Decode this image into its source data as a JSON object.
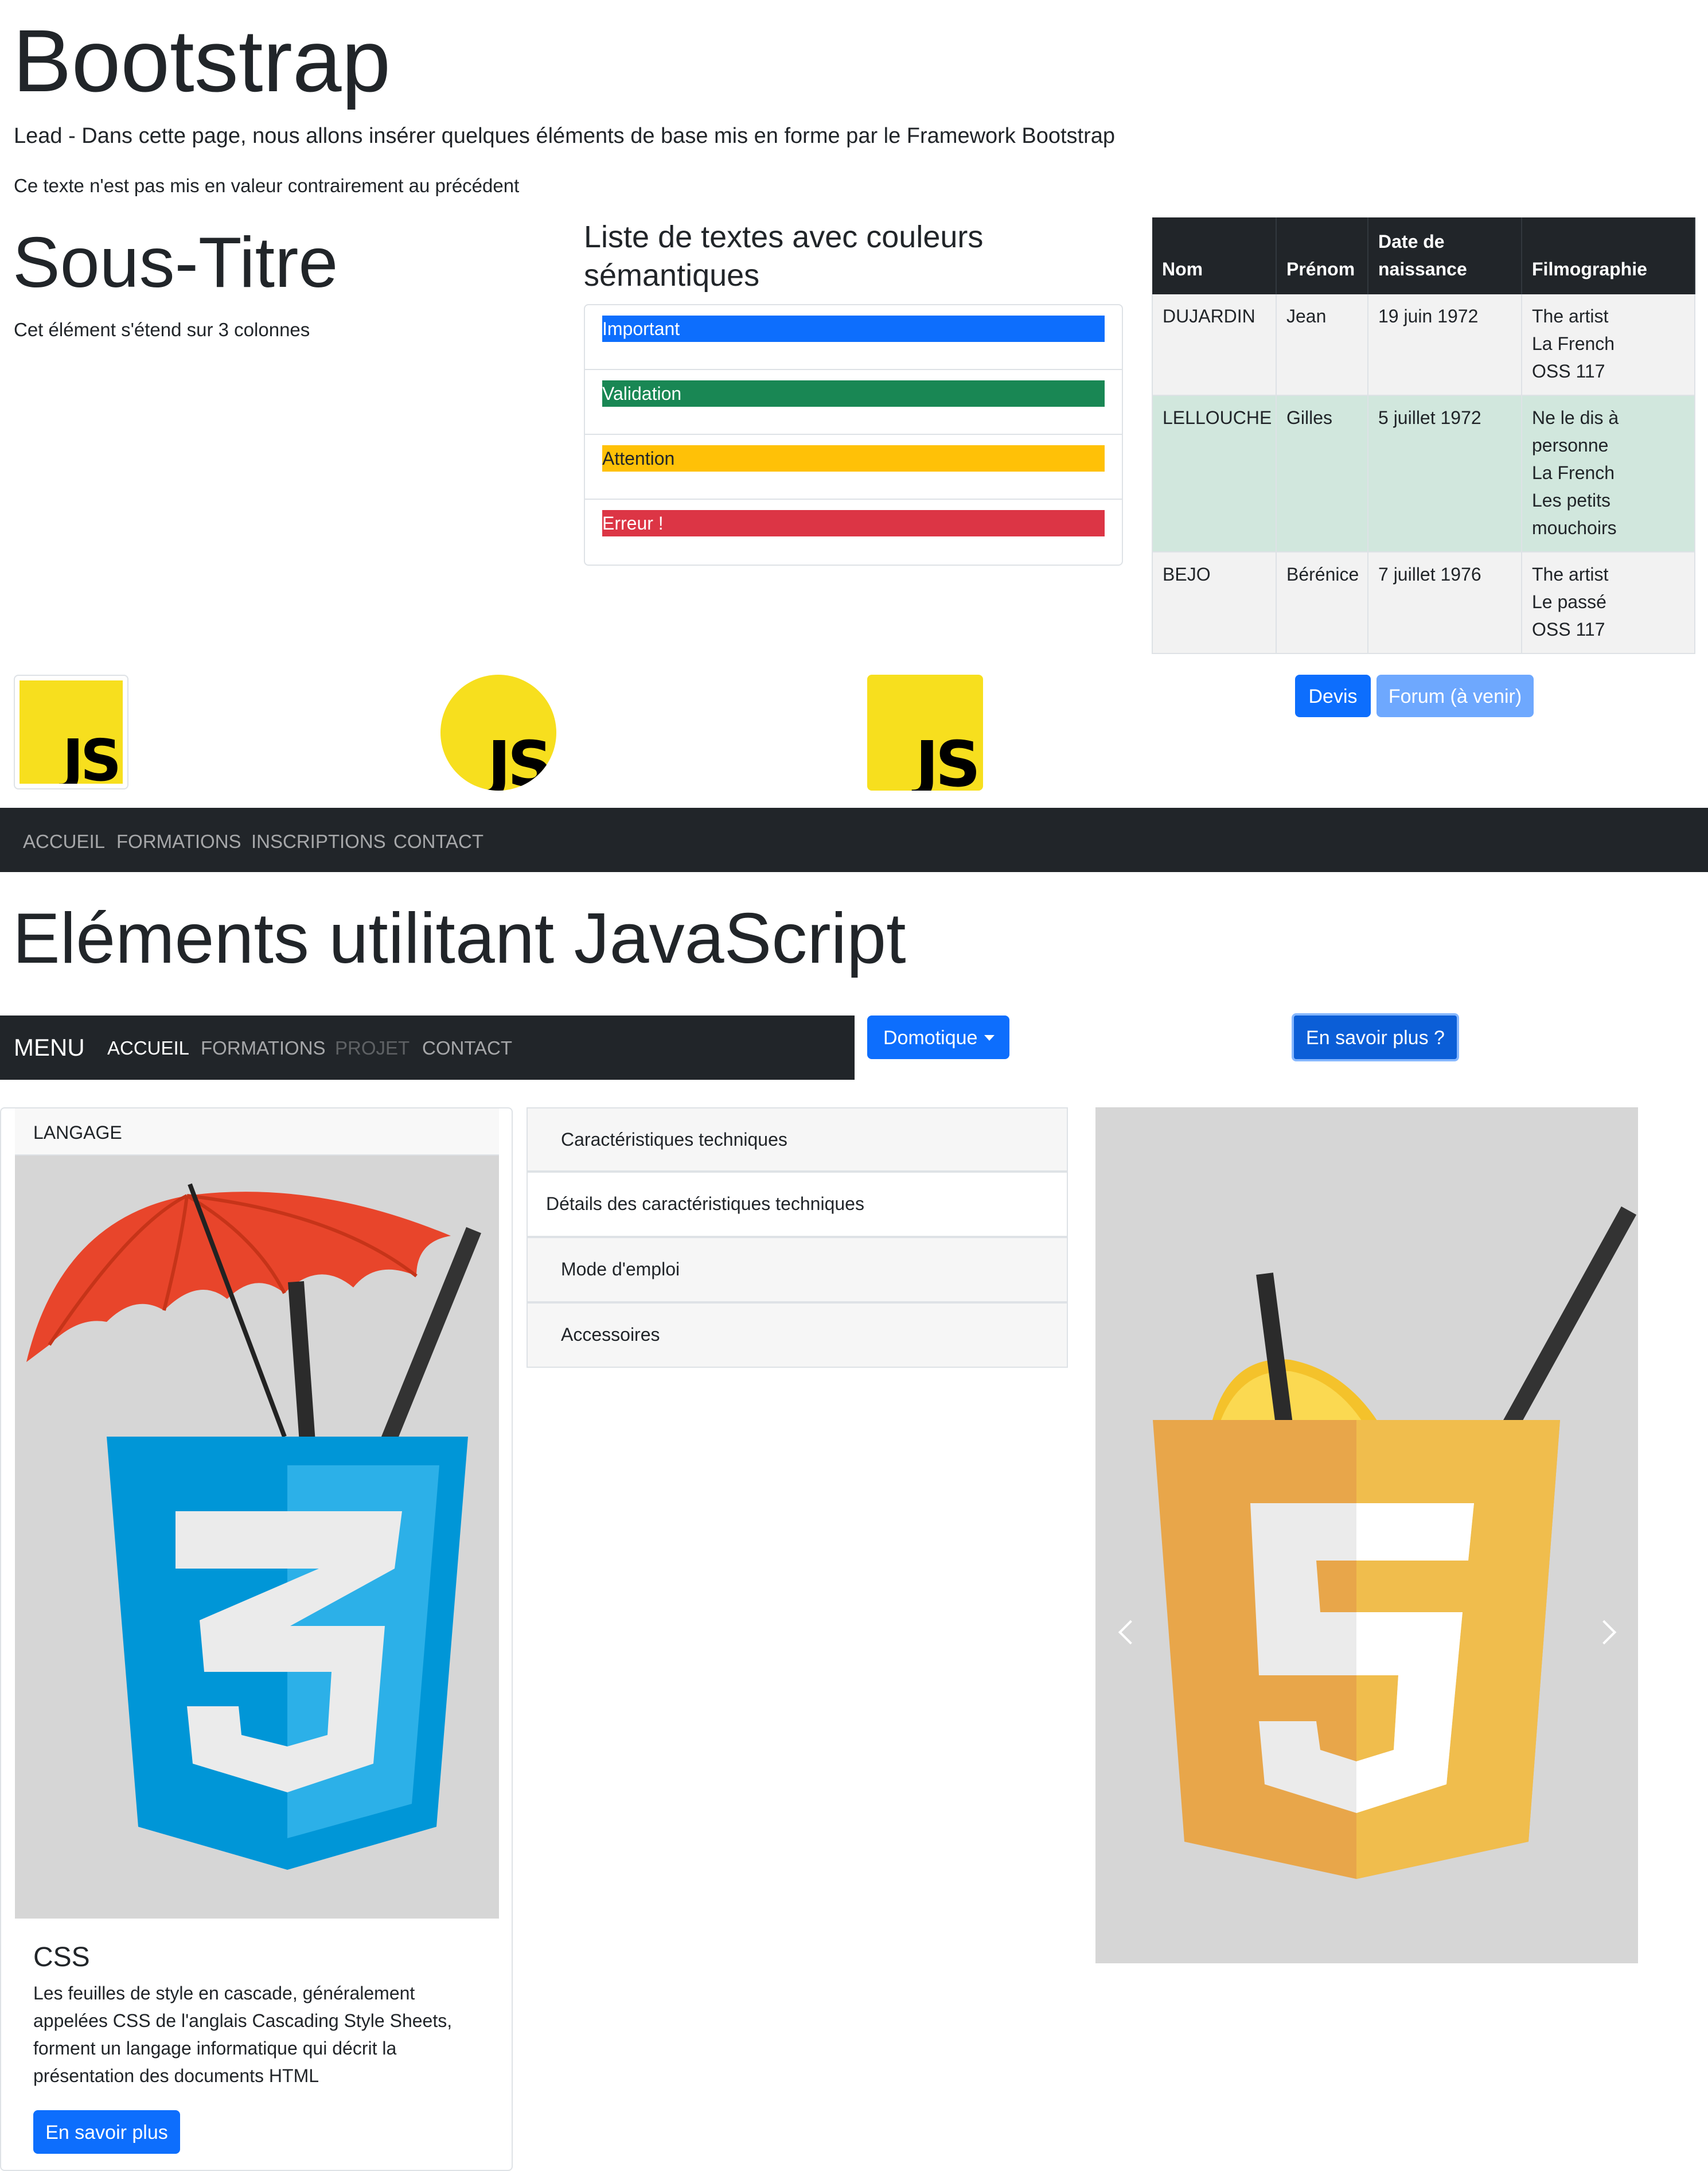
{
  "header": {
    "title": "Bootstrap",
    "lead": "Lead - Dans cette page, nous allons insérer quelques éléments de base mis en forme par le Framework Bootstrap",
    "paragraph": "Ce texte n'est pas mis en valeur contrairement au précédent"
  },
  "section1": {
    "subtitle": "Sous-Titre",
    "description": "Cet élément s'étend sur 3 colonnes"
  },
  "semantic_list": {
    "title": "Liste de textes avec couleurs sémantiques",
    "items": [
      {
        "label": "Important",
        "color": "#0d6efd"
      },
      {
        "label": "Validation",
        "color": "#198754"
      },
      {
        "label": "Attention",
        "color": "#ffc107"
      },
      {
        "label": "Erreur !",
        "color": "#dc3545"
      }
    ]
  },
  "table": {
    "headers": {
      "nom": "Nom",
      "prenom": "Prénom",
      "date": "Date de naissance",
      "films": "Filmographie"
    },
    "rows": [
      {
        "nom": "DUJARDIN",
        "prenom": "Jean",
        "date": "19 juin 1972",
        "films": [
          "The artist",
          "La French",
          "OSS 117"
        ]
      },
      {
        "nom": "LELLOUCHE",
        "prenom": "Gilles",
        "date": "5 juillet 1972",
        "films": [
          "Ne le dis à",
          "personne",
          "La French",
          "Les petits",
          "mouchoirs"
        ]
      },
      {
        "nom": "BEJO",
        "prenom": "Bérénice",
        "date": "7 juillet 1976",
        "films": [
          "The artist",
          "Le passé",
          "OSS 117"
        ]
      }
    ]
  },
  "buttons": {
    "devis": "Devis",
    "forum": "Forum (à venir)"
  },
  "js_logo": {
    "text": "JS",
    "color": "#f7df1e"
  },
  "nav1": {
    "items": [
      "ACCUEIL",
      "FORMATIONS",
      "INSCRIPTIONS",
      "CONTACT"
    ]
  },
  "js_section": {
    "title": "Eléments utilitant JavaScript"
  },
  "nav2": {
    "brand": "MENU",
    "items": [
      {
        "label": "ACCUEIL",
        "state": "active"
      },
      {
        "label": "FORMATIONS",
        "state": "normal"
      },
      {
        "label": "PROJET",
        "state": "disabled"
      },
      {
        "label": "CONTACT",
        "state": "normal"
      }
    ]
  },
  "dropdown": {
    "label": "Domotique"
  },
  "more_button": {
    "label": "En savoir plus ?"
  },
  "card": {
    "header": "LANGAGE",
    "image_icon": "css3-drink-icon",
    "title": "CSS",
    "text": "Les feuilles de style en cascade, généralement appelées CSS de l'anglais Cascading Style Sheets, forment un langage informatique qui décrit la présentation des documents HTML",
    "button": "En savoir plus"
  },
  "accordion": {
    "items": [
      "Caractéristiques techniques",
      "Détails des caractéristiques techniques",
      "Mode d'emploi",
      "Accessoires"
    ]
  },
  "carousel": {
    "image_icon": "html5-drink-icon",
    "prev_icon": "chevron-left-icon",
    "next_icon": "chevron-right-icon"
  }
}
